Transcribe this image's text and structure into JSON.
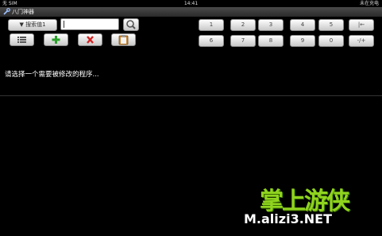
{
  "status_bar": {
    "carrier": "无 SIM",
    "time": "14:41",
    "battery": "未在充电"
  },
  "title_bar": {
    "title": "八门神器"
  },
  "toolbar": {
    "search_type_label": "▼ 搜索值1",
    "search_value": "",
    "numpad_row1": [
      "1",
      "2",
      "3",
      "4",
      "5",
      "|←"
    ],
    "numpad_row2": [
      "6",
      "7",
      "8",
      "9",
      "0",
      "-/+"
    ]
  },
  "icons": {
    "search": "search-icon",
    "list": "list-icon",
    "add": "plus-icon",
    "delete": "close-icon",
    "clipboard": "clipboard-icon"
  },
  "colors": {
    "add": "#2aa02a",
    "delete": "#d42222",
    "watermark_green": "#8fd31f"
  },
  "main": {
    "prompt": "请选择一个需要被修改的程序..."
  },
  "watermark": {
    "brand": "掌上游侠",
    "url": "M.alizi3.NET"
  }
}
